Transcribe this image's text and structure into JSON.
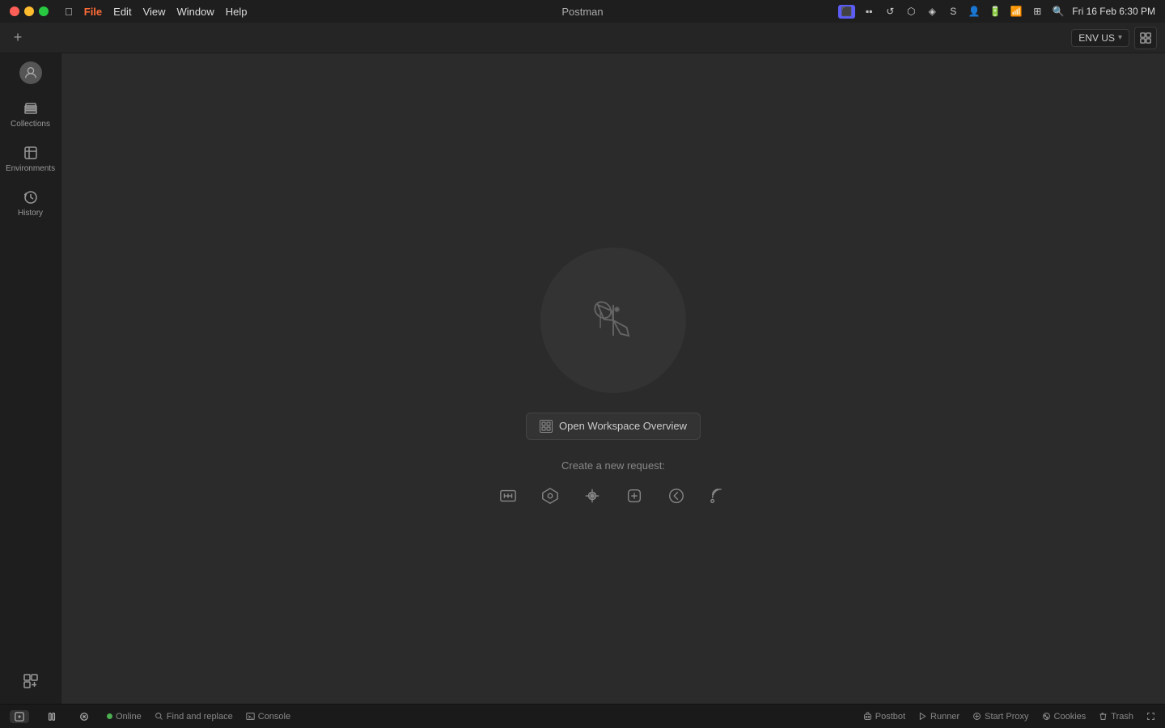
{
  "titlebar": {
    "app_name": "Postman",
    "title": "Postman",
    "menu": [
      "",
      "File",
      "Edit",
      "View",
      "Window",
      "Help"
    ],
    "clock": "Fri 16 Feb  6:30 PM"
  },
  "tabbar": {
    "add_button_label": "+",
    "env_selector": {
      "value": "ENV US",
      "chevron": "▾"
    }
  },
  "sidebar": {
    "avatar_label": "",
    "items": [
      {
        "label": "Collections",
        "id": "collections"
      },
      {
        "label": "Environments",
        "id": "environments"
      },
      {
        "label": "History",
        "id": "history"
      },
      {
        "label": "",
        "id": "addons"
      }
    ]
  },
  "empty_state": {
    "workspace_btn_label": "Open Workspace Overview",
    "new_request_label": "Create a new request:"
  },
  "statusbar": {
    "online_label": "Online",
    "find_replace_label": "Find and replace",
    "console_label": "Console",
    "postbot_label": "Postbot",
    "runner_label": "Runner",
    "start_proxy_label": "Start Proxy",
    "cookies_label": "Cookies",
    "trash_label": "Trash"
  }
}
